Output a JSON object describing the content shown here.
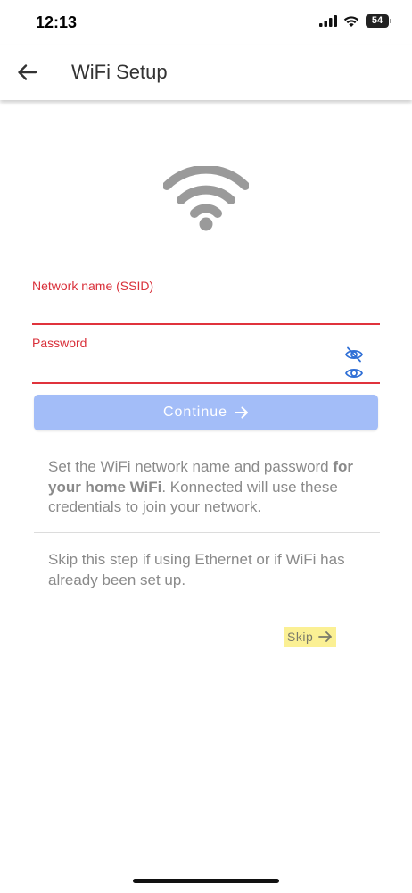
{
  "status_bar": {
    "time": "12:13",
    "battery": "54"
  },
  "app_bar": {
    "title": "WiFi Setup"
  },
  "form": {
    "ssid_label": "Network name (SSID)",
    "ssid_value": "",
    "password_label": "Password",
    "password_value": "",
    "continue_label": "Continue"
  },
  "help": {
    "line_before_bold": "Set the WiFi network name and password",
    "bold": "for your home WiFi",
    "after_bold": ". Konnected will use these credentials to join your network.",
    "skip_hint": "Skip this step if using Ethernet or if WiFi has already been set up."
  },
  "skip": {
    "label": "Skip"
  },
  "colors": {
    "error": "#e0333c",
    "button": "#a3bdf8",
    "highlight": "#fbf094",
    "eye_icon": "#2f6fd6"
  },
  "icons": [
    "back-arrow-icon",
    "wifi-icon",
    "eye-slash-icon",
    "eye-icon",
    "arrow-right-icon"
  ]
}
